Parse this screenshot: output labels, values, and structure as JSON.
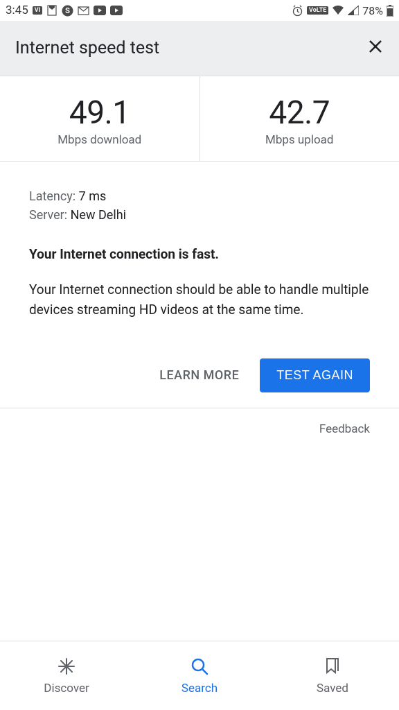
{
  "status_bar": {
    "time": "3:45",
    "battery": "78%",
    "volte": "VoLTE"
  },
  "header": {
    "title": "Internet speed test"
  },
  "speed": {
    "download_value": "49.1",
    "download_label": "Mbps download",
    "upload_value": "42.7",
    "upload_label": "Mbps upload"
  },
  "details": {
    "latency_label": "Latency:",
    "latency_value": "7 ms",
    "server_label": "Server:",
    "server_value": "New Delhi",
    "summary_title": "Your Internet connection is fast.",
    "summary_desc": "Your Internet connection should be able to handle multiple devices streaming HD videos at the same time."
  },
  "actions": {
    "learn_more": "LEARN MORE",
    "test_again": "TEST AGAIN"
  },
  "feedback": "Feedback",
  "nav": {
    "discover": "Discover",
    "search": "Search",
    "saved": "Saved"
  }
}
